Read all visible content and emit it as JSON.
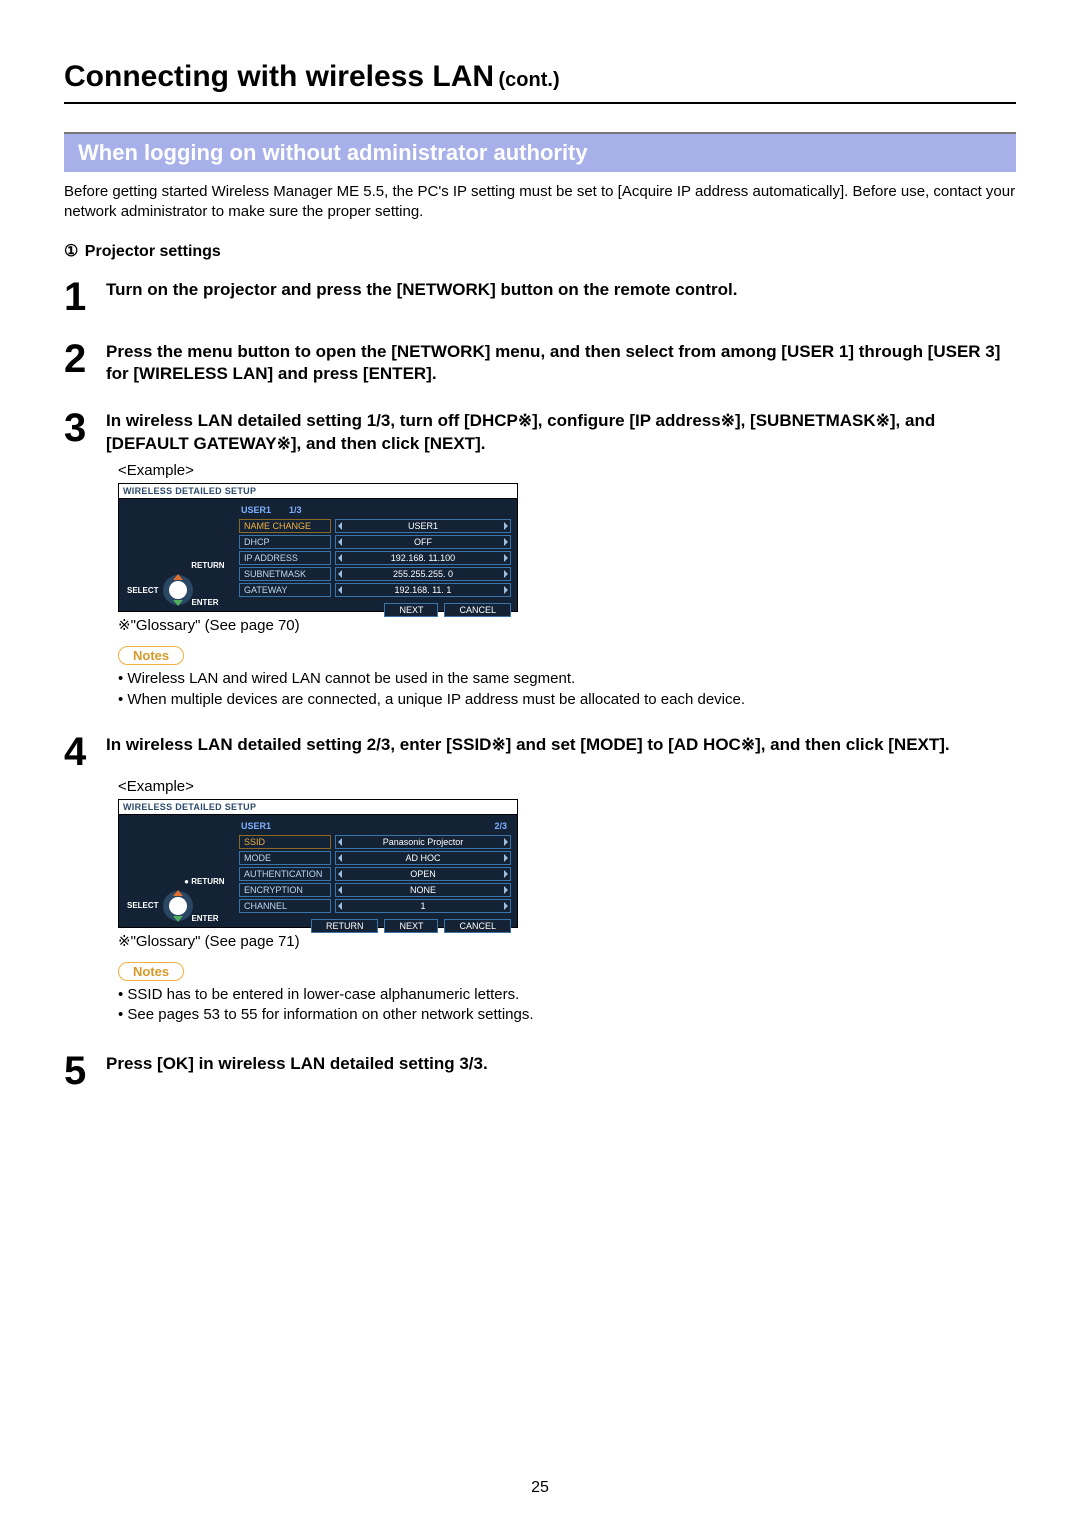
{
  "title": "Connecting with wireless LAN",
  "title_cont": "(cont.)",
  "section_heading": "When logging on without administrator authority",
  "intro": "Before getting started Wireless Manager ME 5.5, the PC's IP setting must be set to [Acquire IP address automatically]. Before use, contact your network administrator to make sure the proper setting.",
  "subheading_marker": "①",
  "subheading": "Projector settings",
  "steps": {
    "1": {
      "num": "1",
      "text": "Turn on the projector and press the [NETWORK] button on the remote control."
    },
    "2": {
      "num": "2",
      "text": "Press the menu button to open the [NETWORK] menu, and then select from among [USER 1] through [USER 3] for [WIRELESS LAN] and press [ENTER]."
    },
    "3": {
      "num": "3",
      "text": "In wireless LAN detailed setting 1/3, turn off [DHCP※], configure [IP address※], [SUBNETMASK※], and [DEFAULT GATEWAY※], and then click [NEXT]."
    },
    "4": {
      "num": "4",
      "text": "In wireless LAN detailed setting 2/3, enter [SSID※] and set [MODE] to [AD HOC※], and then click [NEXT]."
    },
    "5": {
      "num": "5",
      "text": "Press [OK] in wireless LAN detailed setting 3/3."
    }
  },
  "example_label": "<Example>",
  "glossary": {
    "3": "※\"Glossary\" (See page 70)",
    "4": "※\"Glossary\" (See page 71)"
  },
  "notes_label": "Notes",
  "notes": {
    "3": [
      "Wireless LAN and wired LAN cannot be used in the same segment.",
      "When multiple devices are connected, a unique IP address must be allocated to each device."
    ],
    "4": [
      "SSID has to be entered in lower-case alphanumeric letters.",
      "See pages 53 to 55 for information on other network settings."
    ]
  },
  "osd1": {
    "title": "WIRELESS DETAILED SETUP",
    "header_user": "USER1",
    "header_page": "1/3",
    "rows": {
      "namechange": {
        "label": "NAME CHANGE",
        "value": "USER1"
      },
      "dhcp": {
        "label": "DHCP",
        "value": "OFF"
      },
      "ip": {
        "label": "IP ADDRESS",
        "value": "192.168.  11.100"
      },
      "subnet": {
        "label": "SUBNETMASK",
        "value": "255.255.255.   0"
      },
      "gateway": {
        "label": "GATEWAY",
        "value": "192.168.  11.   1"
      }
    },
    "buttons": {
      "next": "NEXT",
      "cancel": "CANCEL"
    },
    "nav": {
      "select": "SELECT",
      "enter": "ENTER",
      "return": "RETURN"
    }
  },
  "osd2": {
    "title": "WIRELESS DETAILED SETUP",
    "header_user": "USER1",
    "header_page": "2/3",
    "rows": {
      "ssid": {
        "label": "SSID",
        "value": "Panasonic Projector"
      },
      "mode": {
        "label": "MODE",
        "value": "AD HOC"
      },
      "auth": {
        "label": "AUTHENTICATION",
        "value": "OPEN"
      },
      "enc": {
        "label": "ENCRYPTION",
        "value": "NONE"
      },
      "channel": {
        "label": "CHANNEL",
        "value": "1"
      }
    },
    "buttons": {
      "return": "RETURN",
      "next": "NEXT",
      "cancel": "CANCEL"
    },
    "nav": {
      "select": "SELECT",
      "enter": "ENTER",
      "return": "RETURN"
    }
  },
  "page_number": "25"
}
